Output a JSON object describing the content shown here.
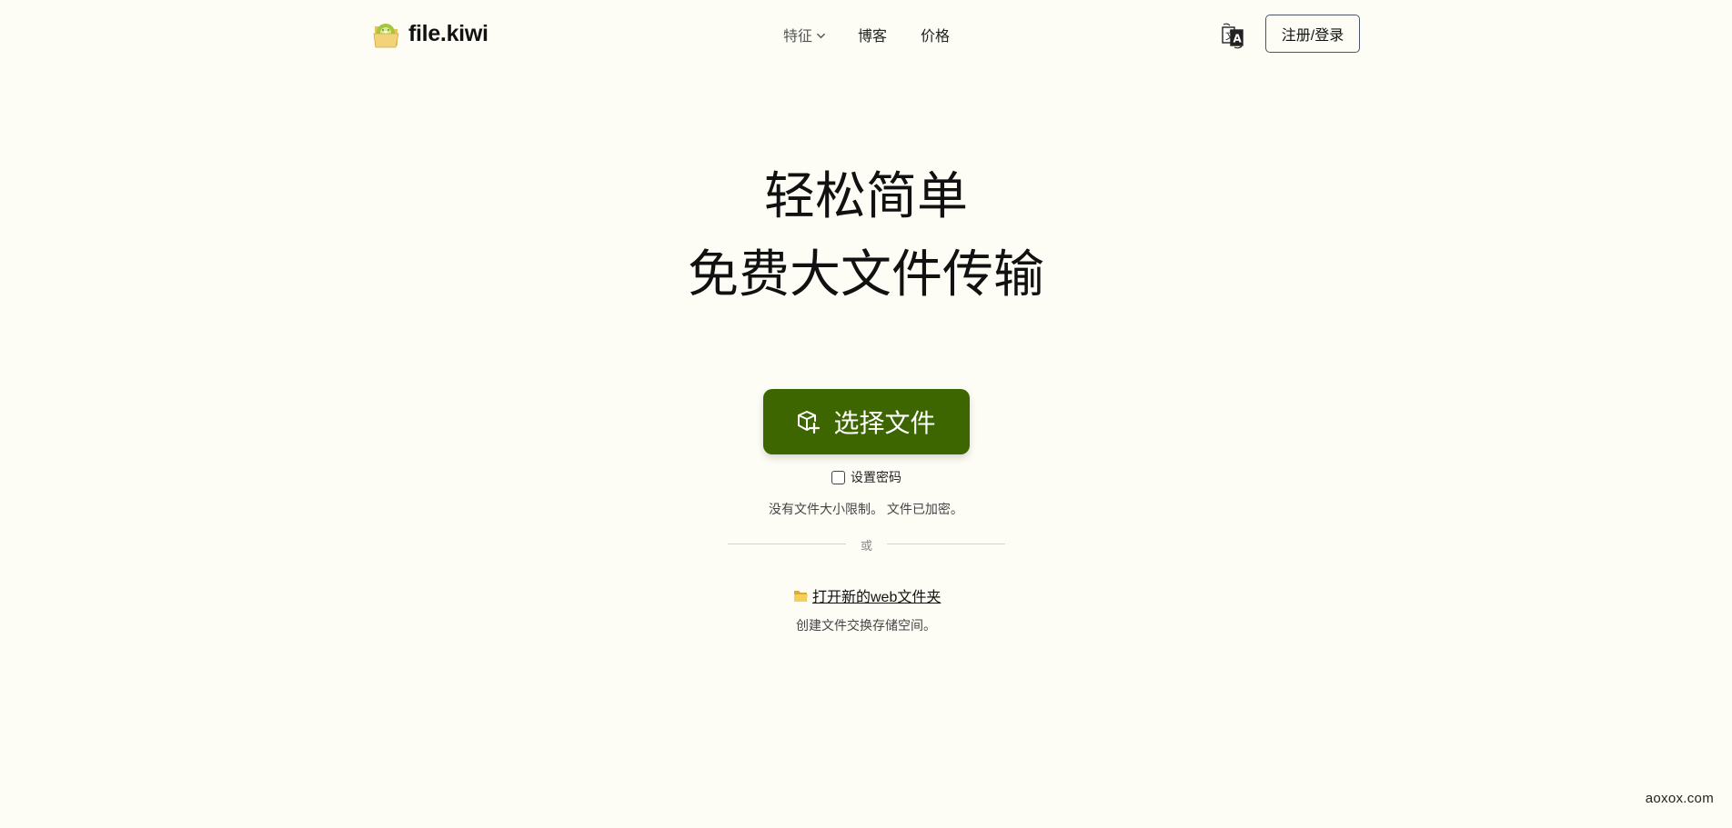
{
  "header": {
    "logo_text": "file.kiwi",
    "nav": {
      "features": "特征",
      "blog": "博客",
      "pricing": "价格"
    },
    "login_label": "注册/登录"
  },
  "hero": {
    "line1": "轻松简单",
    "line2": "免费大文件传输"
  },
  "upload": {
    "cta_label": "选择文件",
    "password_label": "设置密码",
    "password_checked": false,
    "limits_text": "没有文件大小限制。 文件已加密。"
  },
  "divider_text": "或",
  "folder": {
    "link_text": "打开新的web文件夹",
    "description": "创建文件交换存储空间。"
  },
  "watermark": "aoxox.com",
  "icons": {
    "logo": "kiwi-folder-icon",
    "features_chevron": "chevron-down-icon",
    "language": "translate-icon",
    "cta": "add-package-icon",
    "folder": "folder-emoji-icon"
  },
  "colors": {
    "background": "#fdfdf6",
    "accent": "#3d6600",
    "text": "#111111"
  }
}
